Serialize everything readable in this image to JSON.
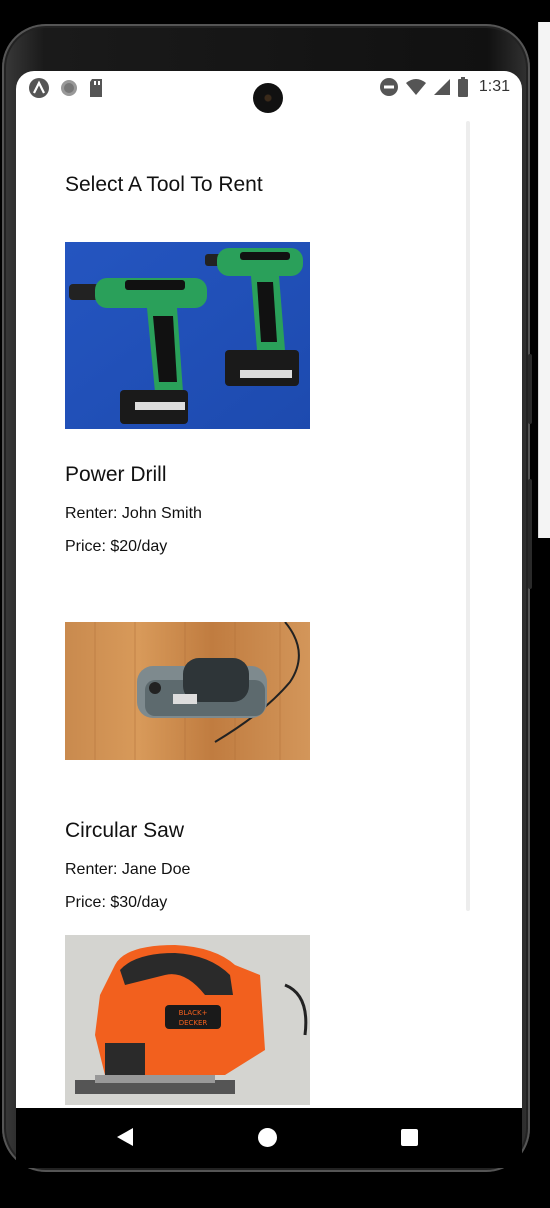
{
  "status_bar": {
    "time": "1:31",
    "left_icons": [
      "app-a-icon",
      "circle-icon",
      "sd-card-icon"
    ],
    "right_icons": [
      "do-not-disturb-icon",
      "wifi-icon",
      "signal-icon",
      "battery-icon"
    ]
  },
  "page": {
    "title": "Select A Tool To Rent"
  },
  "tools": [
    {
      "name": "Power Drill",
      "renter": "Renter: John Smith",
      "price": "Price: $20/day",
      "image": "power-drill-photo"
    },
    {
      "name": "Circular Saw",
      "renter": "Renter: Jane Doe",
      "price": "Price: $30/day",
      "image": "belt-sander-photo"
    },
    {
      "image": "jigsaw-photo",
      "brand_text": "BLACK+DECKER"
    }
  ],
  "nav_bar": {
    "buttons": [
      "back-icon",
      "home-icon",
      "recent-apps-icon"
    ]
  },
  "colors": {
    "drill_background": "#1f4fb8",
    "drill_green": "#2aa05a",
    "floor_wood": "#c98a4e",
    "jigsaw_orange": "#f2601e"
  }
}
